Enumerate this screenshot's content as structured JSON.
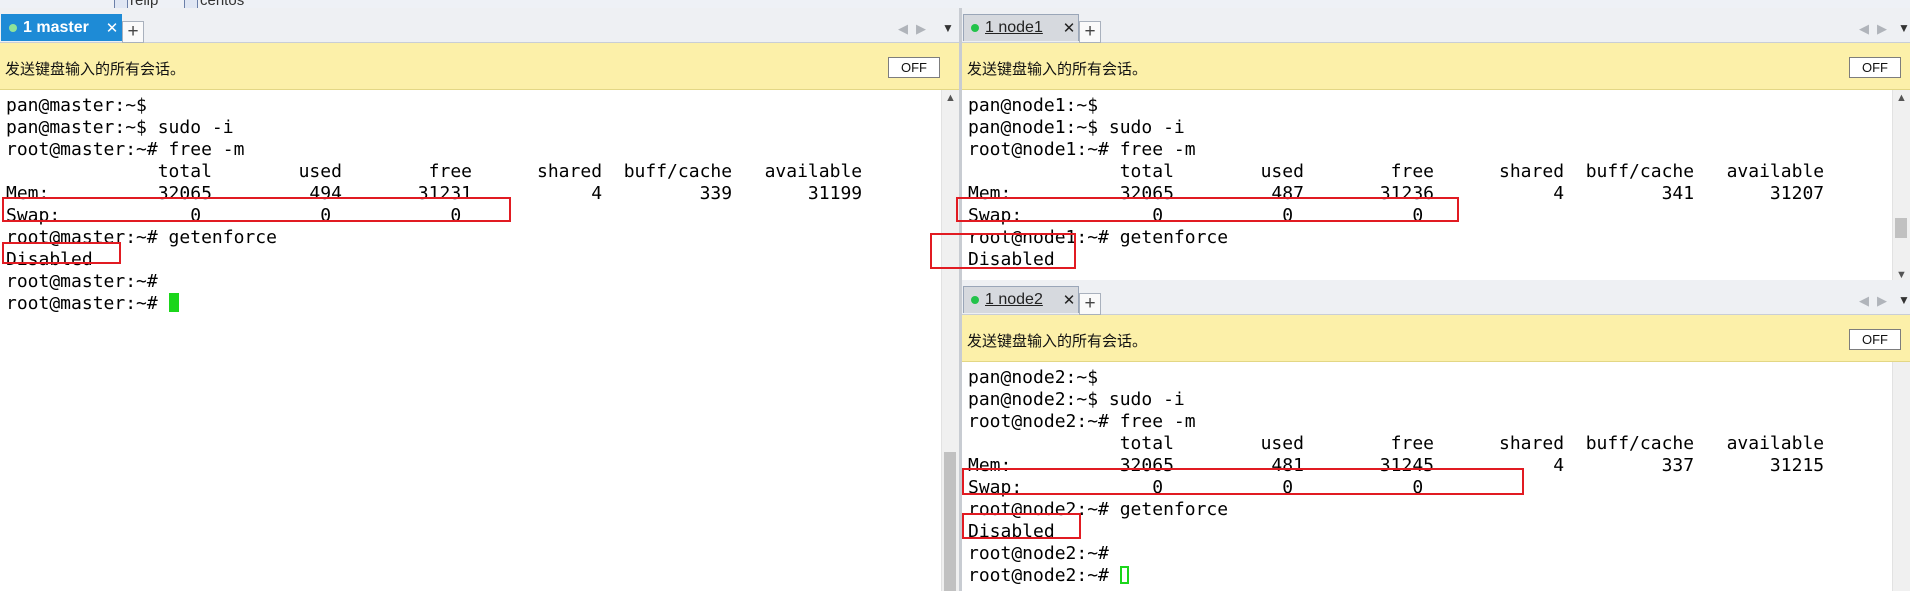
{
  "bookmarks": [
    "relip",
    "centos"
  ],
  "left_pane": {
    "tab_label": "1 master",
    "tab_close": "✕",
    "notice": "发送键盘输入的所有会话。",
    "off_label": "OFF",
    "lines": [
      "pan@master:~$",
      "pan@master:~$ sudo -i",
      "root@master:~# free -m",
      "              total        used        free      shared  buff/cache   available",
      "Mem:          32065         494       31231           4         339       31199",
      "Swap:            0           0           0",
      "root@master:~# getenforce",
      "Disabled",
      "root@master:~#",
      "root@master:~# "
    ]
  },
  "node1_pane": {
    "tab_label": "1 node1",
    "tab_close": "✕",
    "notice": "发送键盘输入的所有会话。",
    "off_label": "OFF",
    "lines": [
      "pan@node1:~$",
      "pan@node1:~$ sudo -i",
      "root@node1:~# free -m",
      "              total        used        free      shared  buff/cache   available",
      "Mem:          32065         487       31236           4         341       31207",
      "Swap:            0           0           0",
      "root@node1:~# getenforce",
      "Disabled"
    ]
  },
  "node2_pane": {
    "tab_label": "1 node2",
    "tab_close": "✕",
    "notice": "发送键盘输入的所有会话。",
    "off_label": "OFF",
    "lines": [
      "pan@node2:~$",
      "pan@node2:~$ sudo -i",
      "root@node2:~# free -m",
      "              total        used        free      shared  buff/cache   available",
      "Mem:          32065         481       31245           4         337       31215",
      "Swap:            0           0           0",
      "root@node2:~# getenforce",
      "Disabled",
      "root@node2:~#",
      "root@node2:~# "
    ]
  },
  "icons": {
    "plus": "+",
    "scroll_up": "▲",
    "scroll_down": "▼",
    "nav_left_right": "◀▶",
    "dropdown": "▼"
  },
  "colors": {
    "active_tab": "#1e8bd6",
    "notice_bg": "#fcf0a9",
    "highlight": "#e11b22",
    "cursor": "#1bd61b",
    "session_dot": "#22c34a"
  }
}
